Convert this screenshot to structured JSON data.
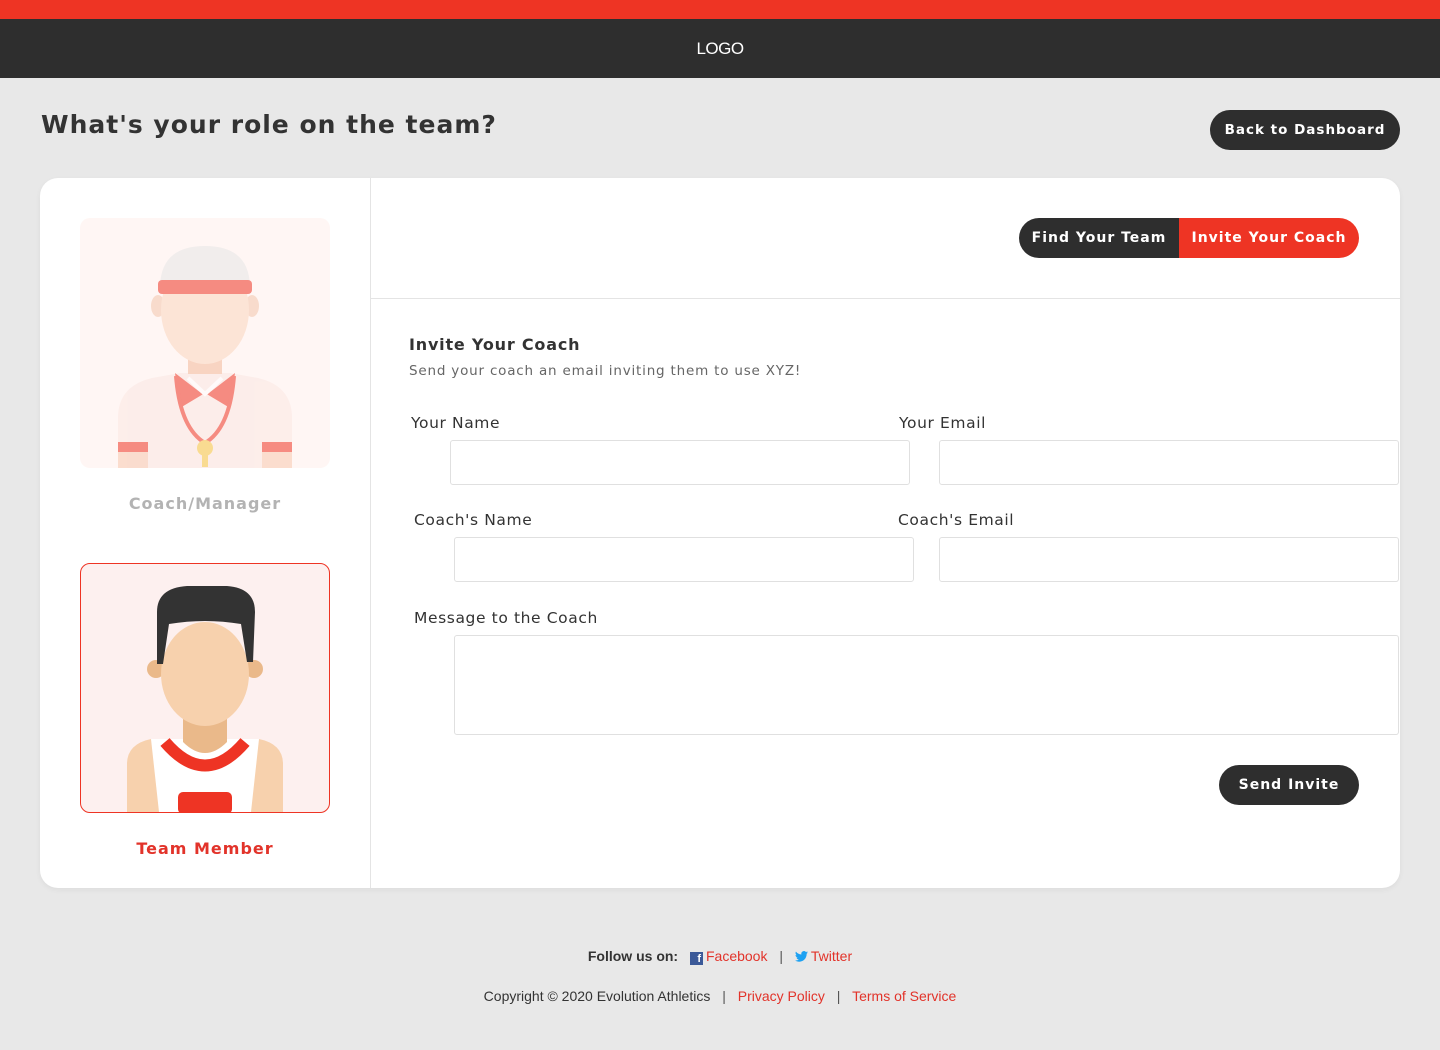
{
  "header": {
    "logo": "LOGO"
  },
  "page": {
    "title": "What's your role on the team?",
    "back_button": "Back to Dashboard"
  },
  "roles": [
    {
      "label": "Coach/Manager",
      "selected": false
    },
    {
      "label": "Team Member",
      "selected": true
    }
  ],
  "tabs": [
    {
      "label": "Find Your Team",
      "active": false
    },
    {
      "label": "Invite Your Coach",
      "active": true
    }
  ],
  "form": {
    "title": "Invite Your Coach",
    "subtitle": "Send your coach an email inviting them to use XYZ!",
    "your_name": {
      "label": "Your Name",
      "value": ""
    },
    "your_email": {
      "label": "Your Email",
      "value": ""
    },
    "coach_name": {
      "label": "Coach's Name",
      "value": ""
    },
    "coach_email": {
      "label": "Coach's Email",
      "value": ""
    },
    "message": {
      "label": "Message to the Coach",
      "value": ""
    },
    "submit": "Send Invite"
  },
  "footer": {
    "follow_label": "Follow us on:",
    "facebook": "Facebook",
    "twitter": "Twitter",
    "separator": "|",
    "copyright": "Copyright © 2020 Evolution Athletics",
    "privacy": "Privacy Policy",
    "terms": "Terms of Service"
  },
  "colors": {
    "accent": "#ee3424",
    "dark": "#2e2e2e",
    "background": "#e8e8e8"
  }
}
